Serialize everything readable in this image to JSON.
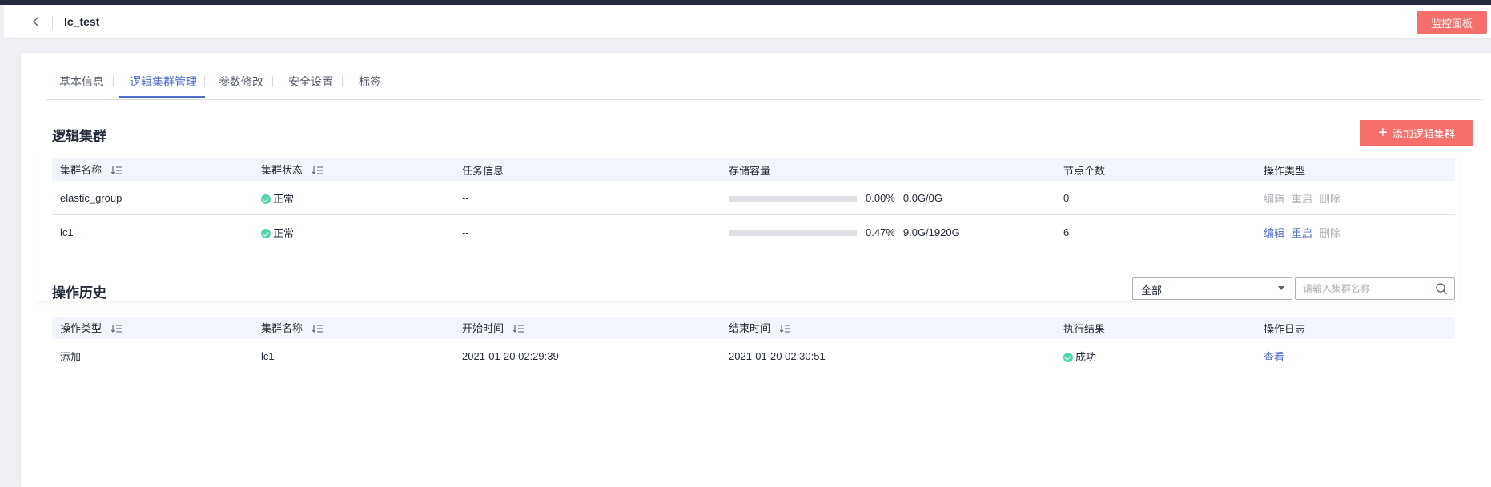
{
  "header": {
    "title": "lc_test",
    "monitor_button": "监控面板"
  },
  "tabs": [
    {
      "label": "基本信息",
      "active": false
    },
    {
      "label": "逻辑集群管理",
      "active": true
    },
    {
      "label": "参数修改",
      "active": false
    },
    {
      "label": "安全设置",
      "active": false
    },
    {
      "label": "标签",
      "active": false
    }
  ],
  "clusters": {
    "title": "逻辑集群",
    "add_button": "添加逻辑集群",
    "columns": [
      "集群名称",
      "集群状态",
      "任务信息",
      "存储容量",
      "节点个数",
      "操作类型"
    ],
    "rows": [
      {
        "name": "elastic_group",
        "status": "正常",
        "task": "--",
        "storage_percent": "0.00%",
        "storage_fraction": 0.0,
        "storage_text": "0.0G/0G",
        "nodes": "0",
        "actions": [
          {
            "label": "编辑",
            "enabled": false
          },
          {
            "label": "重启",
            "enabled": false
          },
          {
            "label": "删除",
            "enabled": false
          }
        ]
      },
      {
        "name": "lc1",
        "status": "正常",
        "task": "--",
        "storage_percent": "0.47%",
        "storage_fraction": 0.0047,
        "storage_text": "9.0G/1920G",
        "nodes": "6",
        "actions": [
          {
            "label": "编辑",
            "enabled": true
          },
          {
            "label": "重启",
            "enabled": true
          },
          {
            "label": "删除",
            "enabled": false
          }
        ]
      }
    ]
  },
  "history": {
    "title": "操作历史",
    "filter_value": "全部",
    "search_placeholder": "请输入集群名称",
    "columns": [
      "操作类型",
      "集群名称",
      "开始时间",
      "结束时间",
      "执行结果",
      "操作日志"
    ],
    "rows": [
      {
        "type": "添加",
        "cluster": "lc1",
        "start": "2021-01-20 02:29:39",
        "end": "2021-01-20 02:30:51",
        "result": "成功",
        "log_link": "查看"
      }
    ]
  },
  "colors": {
    "accent": "#526ecc",
    "primary_button": "#f66f6a",
    "success": "#50d4ab",
    "disabled_text": "#adb0b8"
  }
}
